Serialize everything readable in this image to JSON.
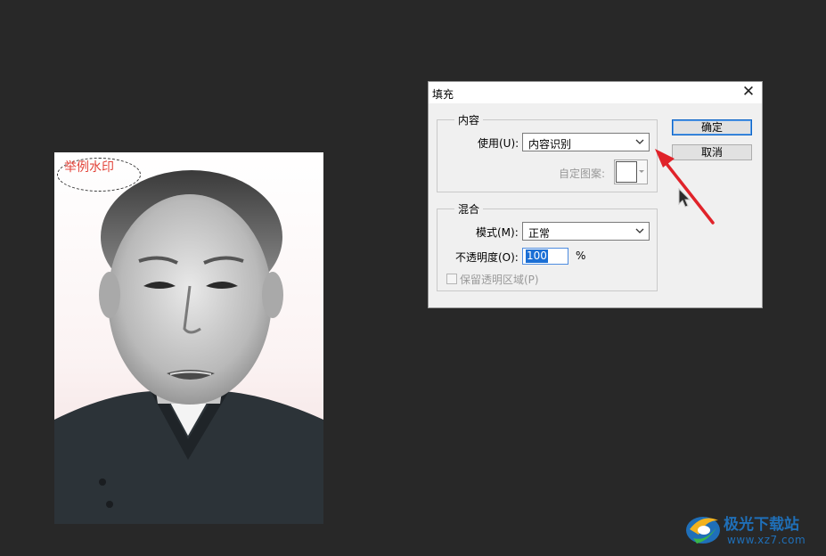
{
  "canvas": {
    "watermark_text": "举例水印"
  },
  "dialog": {
    "title": "填充",
    "close_glyph": "✕",
    "content_group": {
      "legend": "内容",
      "use_label": "使用(U):",
      "use_value": "内容识别",
      "pattern_label": "自定图案:"
    },
    "blend_group": {
      "legend": "混合",
      "mode_label": "模式(M):",
      "mode_value": "正常",
      "opacity_label": "不透明度(O):",
      "opacity_value": "100",
      "opacity_unit": "%",
      "preserve_label": "保留透明区域(P)",
      "preserve_checked": false
    },
    "ok_label": "确定",
    "cancel_label": "取消"
  },
  "branding": {
    "name": "极光下载站",
    "url": "www.xz7.com"
  },
  "colors": {
    "workspace_bg": "#282828",
    "dialog_bg": "#f0f0f0",
    "arrow": "#e0232a",
    "selection": "#1b6fd5",
    "watermark": "#e2443a",
    "brand": "#1f6fb8"
  },
  "icons": {
    "close": "close-icon",
    "dropdown": "chevron-down-icon",
    "cursor": "mouse-cursor-icon",
    "annotation": "red-arrow-icon",
    "brand_logo": "aurora-logo-icon"
  }
}
